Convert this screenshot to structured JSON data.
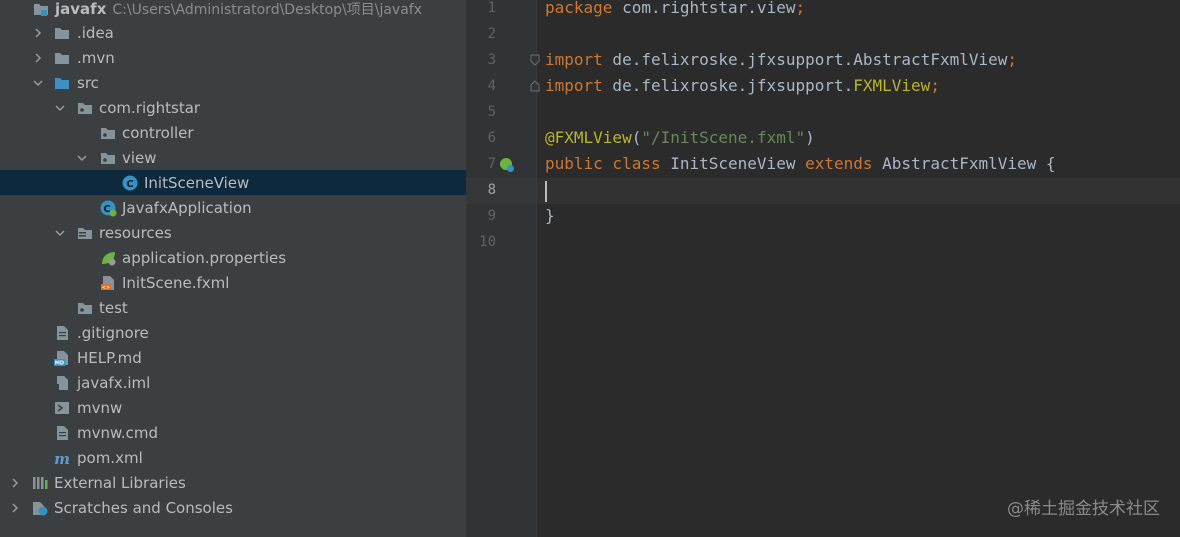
{
  "project": {
    "root": {
      "name": "javafx",
      "path": "C:\\Users\\Administratord\\Desktop\\项目\\javafx"
    },
    "items": [
      {
        "label": "javafx"
      },
      {
        "label": ".idea"
      },
      {
        "label": ".mvn"
      },
      {
        "label": "src"
      },
      {
        "label": "com.rightstar"
      },
      {
        "label": "controller"
      },
      {
        "label": "view"
      },
      {
        "label": "InitSceneView"
      },
      {
        "label": "JavafxApplication"
      },
      {
        "label": "resources"
      },
      {
        "label": "application.properties"
      },
      {
        "label": "InitScene.fxml"
      },
      {
        "label": "test"
      },
      {
        "label": ".gitignore"
      },
      {
        "label": "HELP.md"
      },
      {
        "label": "javafx.iml"
      },
      {
        "label": "mvnw"
      },
      {
        "label": "mvnw.cmd"
      },
      {
        "label": "pom.xml"
      },
      {
        "label": "External Libraries"
      },
      {
        "label": "Scratches and Consoles"
      }
    ]
  },
  "editor": {
    "line_numbers": [
      "1",
      "2",
      "3",
      "4",
      "5",
      "6",
      "7",
      "8",
      "9",
      "10"
    ],
    "active_line": "8",
    "code": {
      "l1_kw": "package",
      "l1_rest": " com.rightstar.view",
      "l1_semi": ";",
      "l3_kw": "import",
      "l3_rest": " de.felixroske.jfxsupport.AbstractFxmlView",
      "l3_semi": ";",
      "l4_kw": "import",
      "l4_rest": " de.felixroske.jfxsupport.",
      "l4_ann": "FXMLView",
      "l4_semi": ";",
      "l6_ann": "@FXMLView",
      "l6_open": "(",
      "l6_str": "\"/InitScene.fxml\"",
      "l6_close": ")",
      "l7_kw1": "public class",
      "l7_name": " InitSceneView ",
      "l7_kw2": "extends",
      "l7_rest": " AbstractFxmlView {",
      "l9": "}"
    }
  },
  "watermark": "@稀土掘金技术社区",
  "colors": {
    "background": "#2b2b2b",
    "sidebar": "#3c3f41",
    "selection": "#0d293e",
    "keyword": "#cc7832",
    "annotation": "#bbb529",
    "string": "#6a8759",
    "text": "#a9b7c6"
  }
}
